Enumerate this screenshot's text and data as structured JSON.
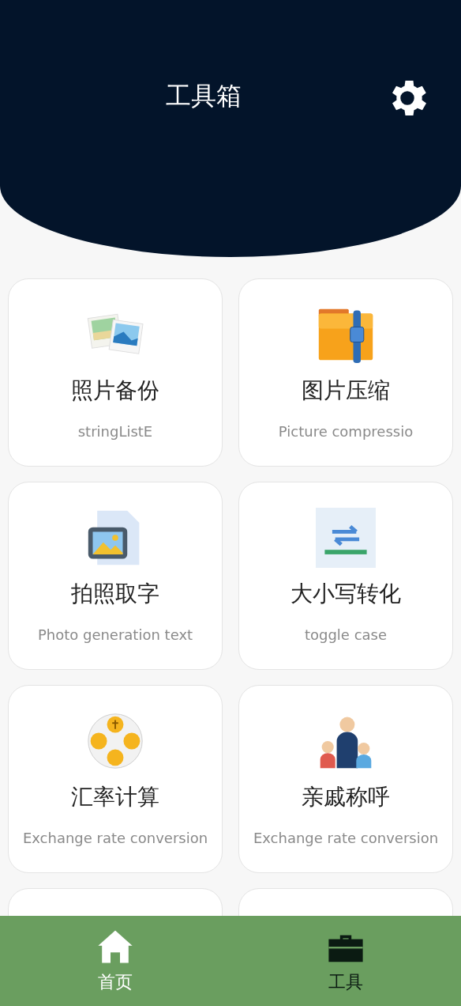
{
  "header": {
    "title": "工具箱"
  },
  "tools": [
    {
      "kind": "photos",
      "title": "照片备份",
      "subtitle": "stringListE"
    },
    {
      "kind": "archive",
      "title": "图片压缩",
      "subtitle": "Picture compressio"
    },
    {
      "kind": "image-file",
      "title": "拍照取字",
      "subtitle": "Photo generation text"
    },
    {
      "kind": "swap",
      "title": "大小写转化",
      "subtitle": "toggle case"
    },
    {
      "kind": "coins",
      "title": "汇率计算",
      "subtitle": "Exchange rate conversion"
    },
    {
      "kind": "family",
      "title": "亲戚称呼",
      "subtitle": "Exchange rate conversion"
    },
    {
      "kind": "hidden"
    },
    {
      "kind": "hidden"
    }
  ],
  "nav": [
    {
      "kind": "home",
      "label": "首页",
      "selected": false
    },
    {
      "kind": "toolbox",
      "label": "工具",
      "selected": true
    }
  ]
}
